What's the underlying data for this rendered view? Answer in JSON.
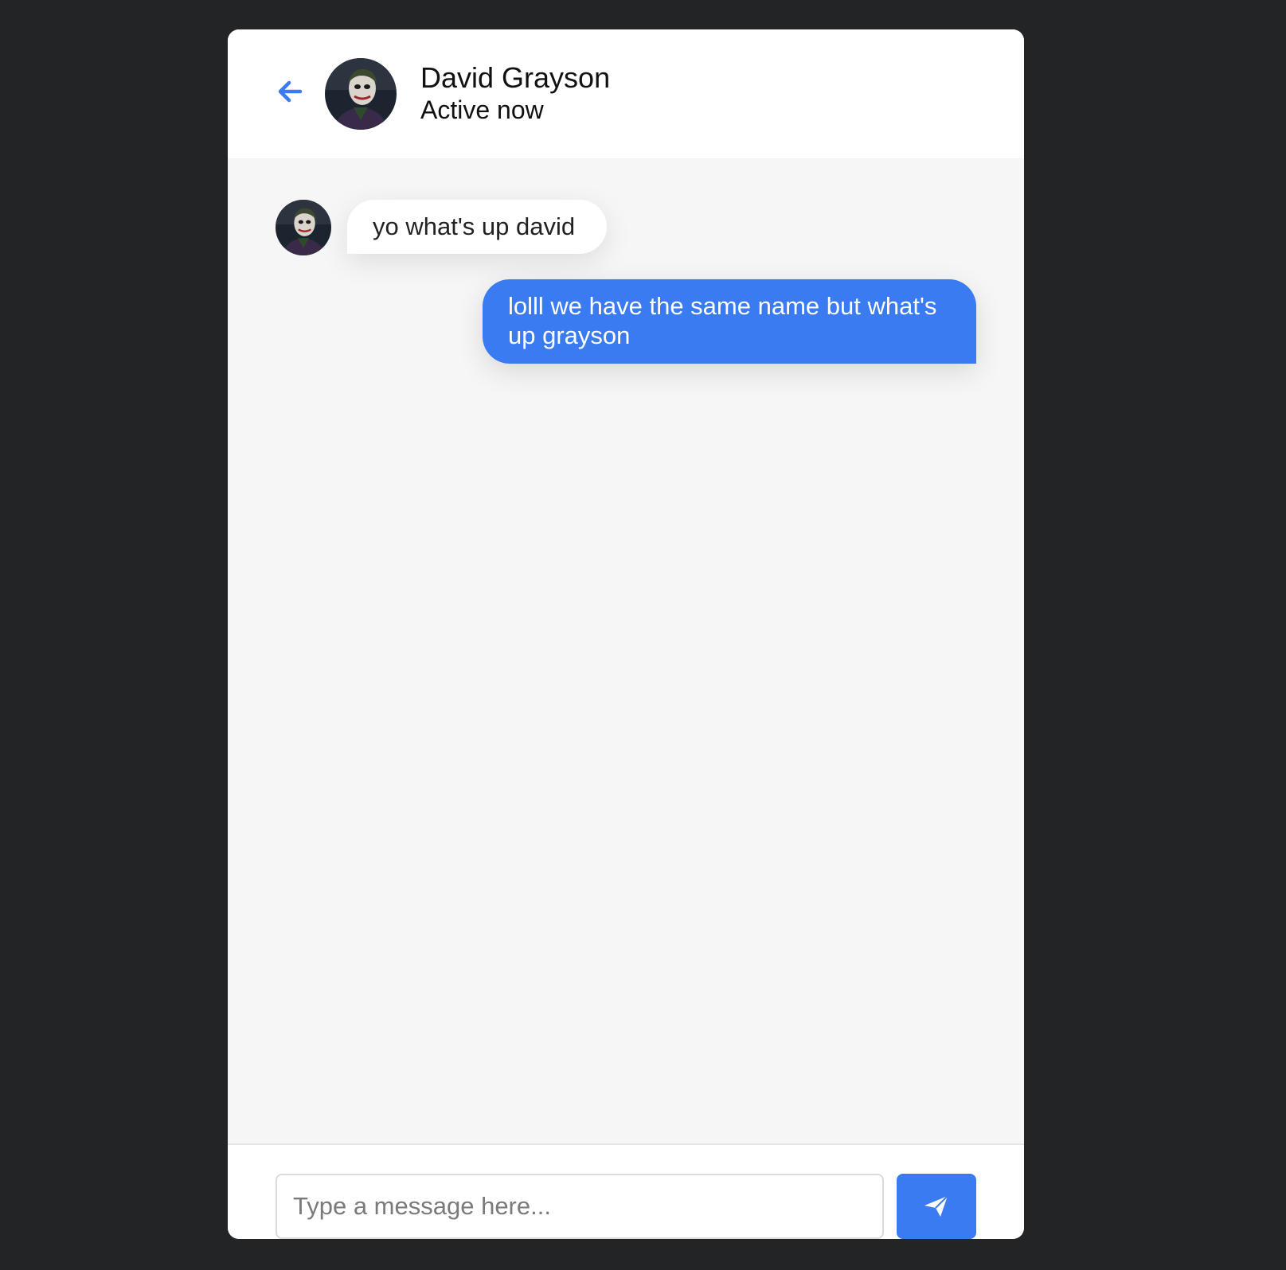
{
  "header": {
    "back_icon": "arrow-left-icon",
    "avatar_icon": "contact-avatar",
    "name": "David Grayson",
    "status": "Active now"
  },
  "messages": [
    {
      "direction": "incoming",
      "text": "yo what's up david"
    },
    {
      "direction": "outgoing",
      "text": "lolll we have the same name but what's up grayson"
    }
  ],
  "composer": {
    "value": "",
    "placeholder": "Type a message here...",
    "send_icon": "paper-plane-icon"
  },
  "colors": {
    "page_background": "#232426",
    "accent": "#3a7bf2",
    "chat_background": "#f6f6f6"
  }
}
